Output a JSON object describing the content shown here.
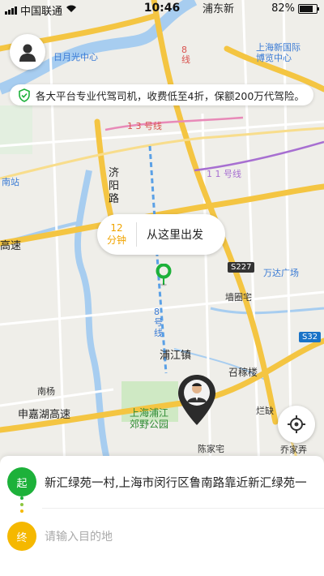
{
  "status_bar": {
    "carrier": "中国联通",
    "time": "10:46",
    "battery": "82%"
  },
  "banner": {
    "text": "各大平台专业代驾司机，收费低至4折，保额200万代驾险。"
  },
  "map": {
    "labels": {
      "pudong_top": "浦东新",
      "sun_center": "日月光中心",
      "expo": "上海新国际\n博览中心",
      "line13": "1 3 号线",
      "line11": "1 1 号线",
      "south_station": "南站",
      "jiyang_road": "济阳路",
      "highway_left": "高速",
      "wanda": "万达广场",
      "line8": "8 号线",
      "qiangwei": "墙圈宅",
      "pujiang_town": "浦江镇",
      "zhaojialou": "召稼楼",
      "nanyang": "南杨",
      "shenjiahu": "申嘉湖高速",
      "park": "上海浦江\n郊野公园",
      "lanque": "烂缺",
      "chenjiazhai": "陈家宅",
      "qiaojianong": "乔家弄",
      "line8_top": "8\n线"
    },
    "badges": {
      "s227": "S227",
      "s32": "S32"
    }
  },
  "pickup_bubble": {
    "minutes": "12",
    "unit": "分钟",
    "action": "从这里出发"
  },
  "trip_panel": {
    "start_badge": "起",
    "start_address": "新汇绿苑一村,上海市闵行区鲁南路靠近新汇绿苑一",
    "end_badge": "终",
    "end_placeholder": "请输入目的地"
  },
  "colors": {
    "green": "#1db13a",
    "yellow": "#f5b800",
    "highway": "#f4c542",
    "water": "#a7cdf0",
    "map_bg": "#efeee9"
  }
}
